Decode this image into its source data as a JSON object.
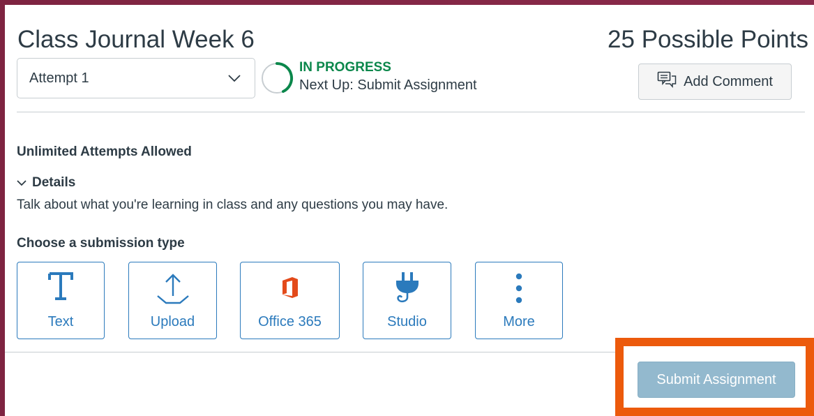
{
  "assignment": {
    "title": "Class Journal Week 6",
    "points": "25 Possible Points"
  },
  "attempt_select": {
    "selected": "Attempt 1"
  },
  "status": {
    "label": "IN PROGRESS",
    "next_step": "Next Up: Submit Assignment"
  },
  "actions": {
    "add_comment_label": "Add Comment",
    "submit_label": "Submit Assignment"
  },
  "info": {
    "attempts_allowed": "Unlimited Attempts Allowed",
    "details_toggle": "Details",
    "details_text": "Talk about what you're learning in class and any questions you may have.",
    "choose_type_label": "Choose a submission type"
  },
  "submission_types": [
    {
      "label": "Text",
      "icon": "text-icon"
    },
    {
      "label": "Upload",
      "icon": "upload-icon"
    },
    {
      "label": "Office 365",
      "icon": "office365-icon"
    },
    {
      "label": "Studio",
      "icon": "plug-icon"
    },
    {
      "label": "More",
      "icon": "more-vertical-icon"
    }
  ],
  "colors": {
    "frame": "#7e2441",
    "accent_blue": "#2b7abc",
    "status_green": "#0b874b",
    "highlight_orange": "#ec5a0c",
    "submit_disabled": "#93b9ce",
    "office_red": "#e34a1a"
  }
}
